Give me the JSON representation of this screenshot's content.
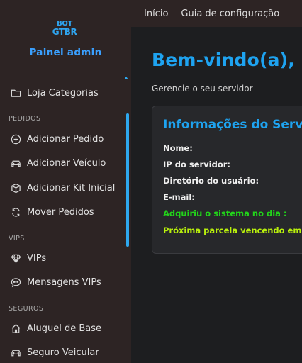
{
  "brand": {
    "logo_line1": "BOT",
    "logo_line2": "GTBR",
    "title": "Painel admin"
  },
  "topbar": {
    "links": [
      {
        "label": "Início"
      },
      {
        "label": "Guia de configuração"
      }
    ]
  },
  "sidebar": {
    "items": [
      {
        "label": "Loja Categorias",
        "icon": "folder-icon"
      },
      {
        "label": "Adicionar Pedido",
        "icon": "plus-circle-icon"
      },
      {
        "label": "Adicionar Veículo",
        "icon": "car-icon"
      },
      {
        "label": "Adicionar Kit Inicial",
        "icon": "box-icon"
      },
      {
        "label": "Mover Pedidos",
        "icon": "refresh-icon"
      },
      {
        "label": "VIPs",
        "icon": "diamond-icon"
      },
      {
        "label": "Mensagens VIPs",
        "icon": "chat-icon"
      },
      {
        "label": "Aluguel de Base",
        "icon": "home-icon"
      },
      {
        "label": "Seguro Veicular",
        "icon": "car-icon"
      }
    ],
    "sections": {
      "pedidos": "PEDIDOS",
      "vips": "VIPS",
      "seguros": "SEGUROS"
    }
  },
  "main": {
    "welcome": "Bem-vindo(a),",
    "subtitle": "Gerencie o seu servidor",
    "card": {
      "title": "Informações do Servidor",
      "fields": {
        "nome": "Nome:",
        "ip": "IP do servidor:",
        "diretorio": "Diretório do usuário:",
        "email": "E-mail:",
        "adquiriu": "Adquiriu o sistema no dia :",
        "parcela": "Próxima parcela vencendo em :"
      }
    }
  },
  "colors": {
    "accent": "#1ea3f0",
    "sidebar_bg": "#2d2424",
    "main_bg": "#1d1e20",
    "green": "#22d41a",
    "lime": "#b9f00c"
  }
}
